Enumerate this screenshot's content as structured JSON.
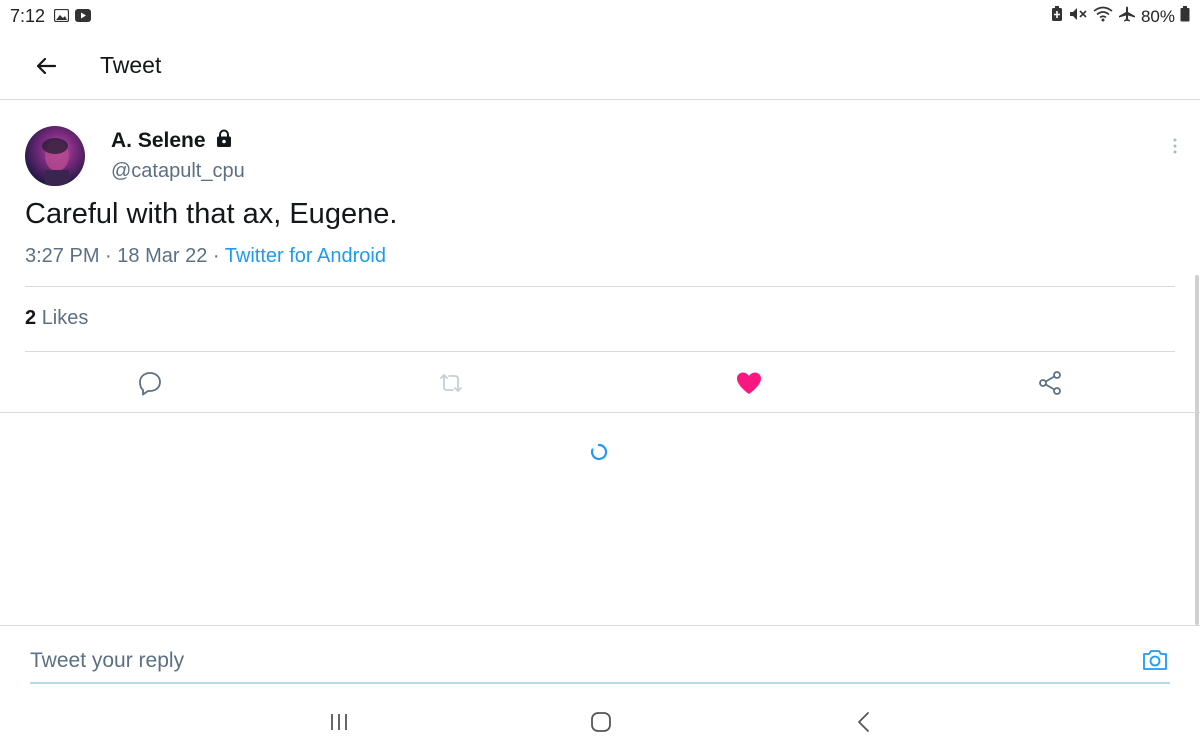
{
  "status_bar": {
    "time": "7:12",
    "left_icons": [
      "image-icon",
      "youtube-icon"
    ],
    "right_icons": [
      "battery-saver-icon",
      "mute-icon",
      "wifi-icon",
      "airplane-icon"
    ],
    "battery": "80%"
  },
  "header": {
    "title": "Tweet"
  },
  "tweet": {
    "display_name": "A. Selene",
    "handle": "@catapult_cpu",
    "text": "Careful with that ax, Eugene.",
    "time": "3:27 PM",
    "separator": "·",
    "date": "18 Mar 22",
    "source": "Twitter for Android",
    "likes_count": "2",
    "likes_label": "Likes",
    "liked": true,
    "colors": {
      "link": "#1d9bf0",
      "like": "#f91880",
      "muted": "#5b7083"
    }
  },
  "actions": [
    "reply-icon",
    "retweet-icon",
    "like-icon",
    "share-icon"
  ],
  "reply": {
    "placeholder": "Tweet your reply"
  },
  "nav": [
    "recent-apps-icon",
    "home-icon",
    "back-nav-icon"
  ]
}
